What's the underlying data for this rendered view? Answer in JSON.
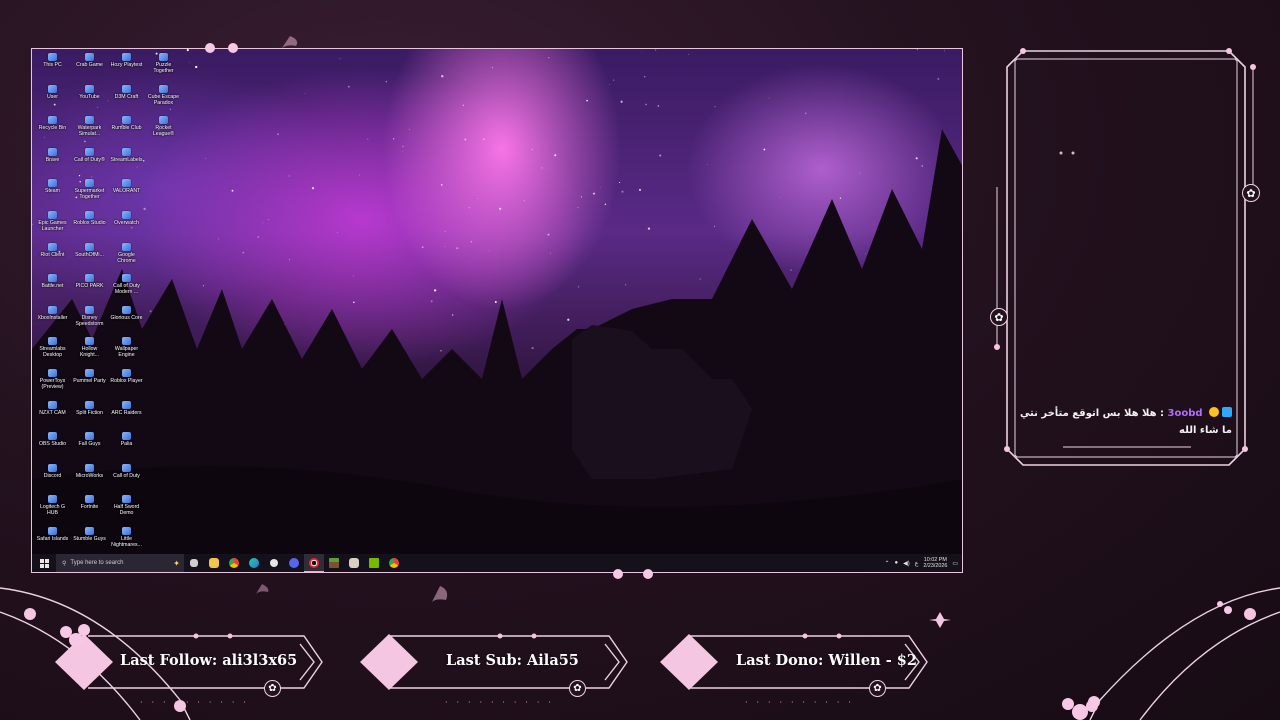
{
  "desktop": {
    "icons": [
      "This PC",
      "Crab Game",
      "Hozy Playtest",
      "Puzzle Together",
      "User",
      "YouTube",
      "D3M Craft",
      "Cube Escape Paradox",
      "Recycle Bin",
      "Waterpark Simulat...",
      "Rumble Club",
      "Rocket League®",
      "Brave",
      "Call of Duty®",
      "StreamLabels",
      "",
      "Steam",
      "Supermarket Together",
      "VALORANT",
      "",
      "Epic Games Launcher",
      "Roblox Studio",
      "Overwatch",
      "",
      "Riot Client",
      "SouthOfMi...",
      "Google Chrome",
      "",
      "Battle.net",
      "PICO PARK",
      "Call of Duty Modern ...",
      "",
      "XboxInstaller",
      "Disney Speedstorm",
      "Glorious Core",
      "",
      "Streamlabs Desktop",
      "Hollow Knight...",
      "Wallpaper Engine",
      "",
      "PowerToys (Preview)",
      "Pummel Party",
      "Roblox Player",
      "",
      "NZXT CAM",
      "Split Fiction",
      "ARC Raiders",
      "",
      "OBS Studio",
      "Fall Guys",
      "Palia",
      "",
      "Discord",
      "MicroWorks",
      "Call of Duty",
      "",
      "Logitech G HUB",
      "Fortnite",
      "Half Sword Demo",
      "",
      "Safari Islands",
      "Stumble Guys",
      "Little Nightmares...",
      ""
    ],
    "taskbar": {
      "search_placeholder": "Type here to search",
      "start_icon": "windows-logo",
      "apps": [
        "widgets",
        "store",
        "file-explorer",
        "chrome",
        "edge",
        "obs",
        "discord",
        "recording",
        "minecraft",
        "app",
        "nvidia",
        "chrome-2"
      ],
      "clock_time": "10:02 PM",
      "clock_date": "2/23/2026",
      "lang": "ع"
    }
  },
  "chat": {
    "username": "3oobd",
    "message": "هلا هلا بس اتوقع متأخر نتي ما شاء الله",
    "separator": ":"
  },
  "stats": {
    "last_follow": "Last Follow: ali3l3x65",
    "last_sub": "Last Sub: Aila55",
    "last_dono": "Last Dono: Willen - $2"
  },
  "colors": {
    "accent": "#f4c6e2",
    "frame": "#ecd2e3",
    "background": "#24121f",
    "username": "#b46cff"
  }
}
